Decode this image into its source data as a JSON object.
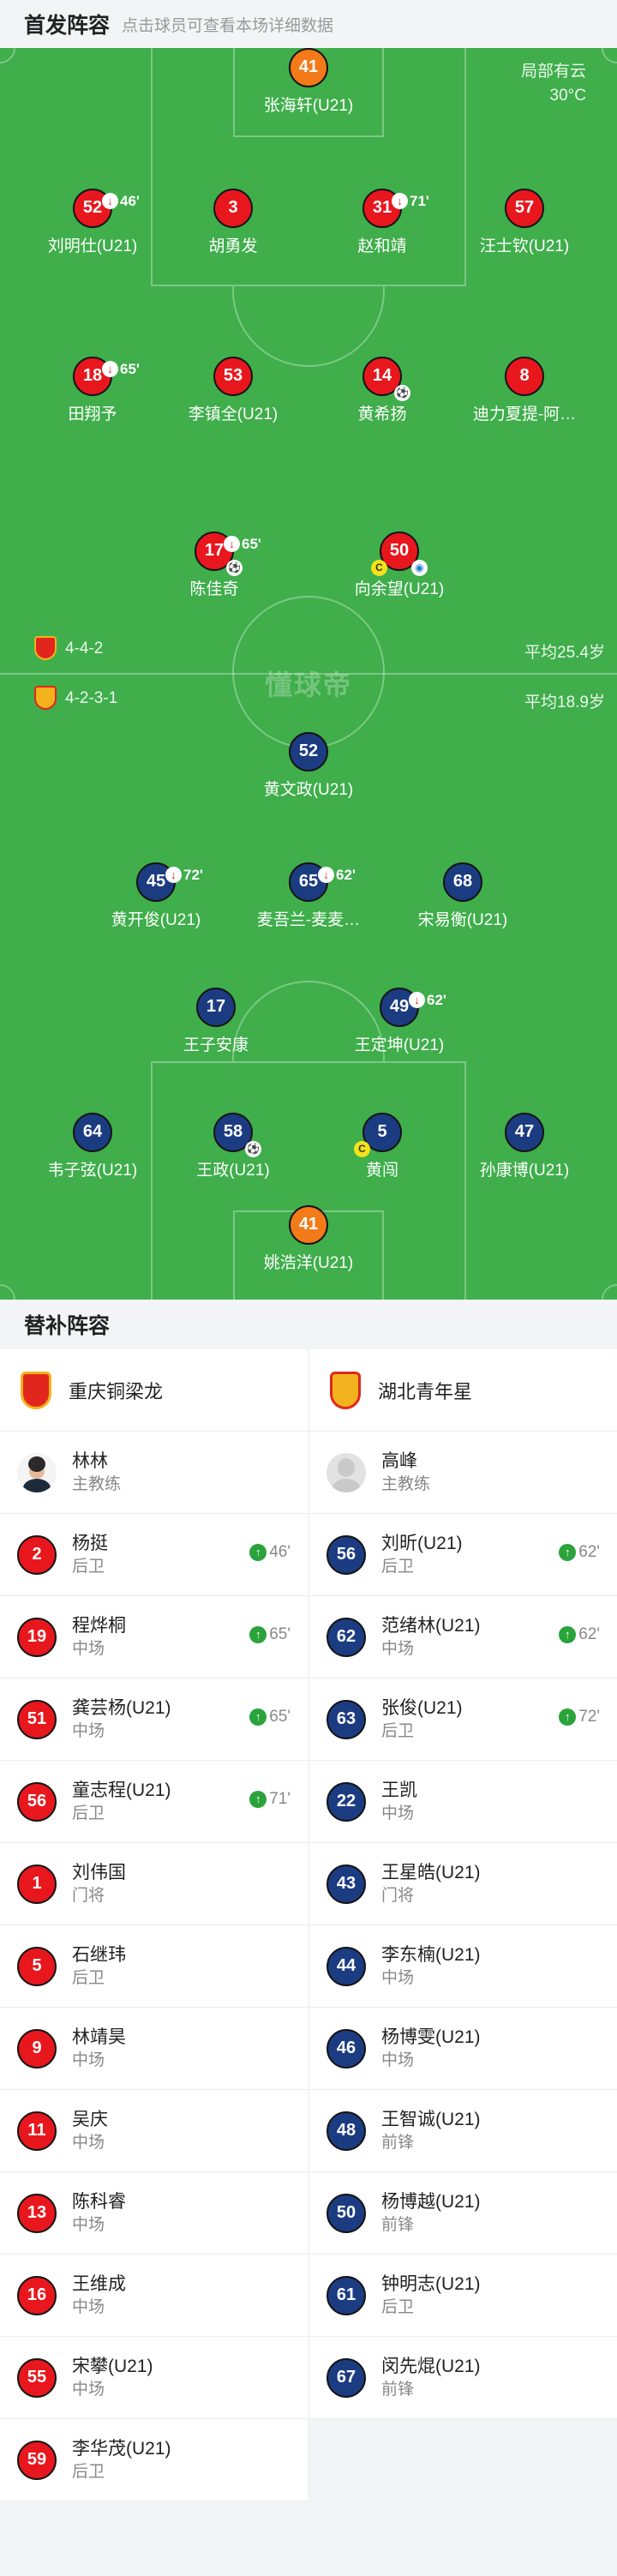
{
  "header": {
    "title": "首发阵容",
    "hint": "点击球员可查看本场详细数据"
  },
  "weather": {
    "condition": "局部有云",
    "temperature": "30°C"
  },
  "watermark": "懂球帝",
  "home": {
    "formation": "4-4-2",
    "avg_age": "平均25.4岁",
    "players": [
      {
        "number": "41",
        "name": "张海轩(U21)"
      },
      {
        "number": "52",
        "name": "刘明仕(U21)",
        "sub_min": "46'"
      },
      {
        "number": "3",
        "name": "胡勇发"
      },
      {
        "number": "31",
        "name": "赵和靖",
        "sub_min": "71'"
      },
      {
        "number": "57",
        "name": "汪士钦(U21)"
      },
      {
        "number": "18",
        "name": "田翔予",
        "sub_min": "65'"
      },
      {
        "number": "53",
        "name": "李镇全(U21)"
      },
      {
        "number": "14",
        "name": "黄希扬"
      },
      {
        "number": "8",
        "name": "迪力夏提-阿…"
      },
      {
        "number": "17",
        "name": "陈佳奇",
        "sub_min": "65'"
      },
      {
        "number": "50",
        "name": "向余望(U21)"
      }
    ]
  },
  "away": {
    "formation": "4-2-3-1",
    "avg_age": "平均18.9岁",
    "players": [
      {
        "number": "52",
        "name": "黄文政(U21)"
      },
      {
        "number": "45",
        "name": "黄开俊(U21)",
        "sub_min": "72'"
      },
      {
        "number": "65",
        "name": "麦吾兰-麦麦…",
        "sub_min": "62'"
      },
      {
        "number": "68",
        "name": "宋易衡(U21)"
      },
      {
        "number": "17",
        "name": "王子安康"
      },
      {
        "number": "49",
        "name": "王定坤(U21)",
        "sub_min": "62'"
      },
      {
        "number": "64",
        "name": "韦子弦(U21)"
      },
      {
        "number": "58",
        "name": "王政(U21)"
      },
      {
        "number": "5",
        "name": "黄闯"
      },
      {
        "number": "47",
        "name": "孙康博(U21)"
      },
      {
        "number": "41",
        "name": "姚浩洋(U21)"
      }
    ]
  },
  "bench": {
    "title": "替补阵容",
    "home_team": "重庆铜梁龙",
    "away_team": "湖北青年星",
    "home_coach": {
      "name": "林林",
      "role": "主教练"
    },
    "away_coach": {
      "name": "高峰",
      "role": "主教练"
    },
    "home_subs": [
      {
        "number": "2",
        "name": "杨挺",
        "position": "后卫",
        "sub_in": "46'"
      },
      {
        "number": "19",
        "name": "程烨桐",
        "position": "中场",
        "sub_in": "65'"
      },
      {
        "number": "51",
        "name": "龚芸杨(U21)",
        "position": "中场",
        "sub_in": "65'"
      },
      {
        "number": "56",
        "name": "童志程(U21)",
        "position": "后卫",
        "sub_in": "71'"
      },
      {
        "number": "1",
        "name": "刘伟国",
        "position": "门将"
      },
      {
        "number": "5",
        "name": "石继玮",
        "position": "后卫"
      },
      {
        "number": "9",
        "name": "林靖昊",
        "position": "中场"
      },
      {
        "number": "11",
        "name": "吴庆",
        "position": "中场"
      },
      {
        "number": "13",
        "name": "陈科睿",
        "position": "中场"
      },
      {
        "number": "16",
        "name": "王维成",
        "position": "中场"
      },
      {
        "number": "55",
        "name": "宋攀(U21)",
        "position": "中场"
      },
      {
        "number": "59",
        "name": "李华茂(U21)",
        "position": "后卫"
      }
    ],
    "away_subs": [
      {
        "number": "56",
        "name": "刘昕(U21)",
        "position": "后卫",
        "sub_in": "62'"
      },
      {
        "number": "62",
        "name": "范绪林(U21)",
        "position": "中场",
        "sub_in": "62'"
      },
      {
        "number": "63",
        "name": "张俊(U21)",
        "position": "后卫",
        "sub_in": "72'"
      },
      {
        "number": "22",
        "name": "王凯",
        "position": "中场"
      },
      {
        "number": "43",
        "name": "王星皓(U21)",
        "position": "门将"
      },
      {
        "number": "44",
        "name": "李东楠(U21)",
        "position": "中场"
      },
      {
        "number": "46",
        "name": "杨博雯(U21)",
        "position": "中场"
      },
      {
        "number": "48",
        "name": "王智诚(U21)",
        "position": "前锋"
      },
      {
        "number": "50",
        "name": "杨博越(U21)",
        "position": "前锋"
      },
      {
        "number": "61",
        "name": "钟明志(U21)",
        "position": "后卫"
      },
      {
        "number": "67",
        "name": "闵先焜(U21)",
        "position": "前锋"
      }
    ]
  }
}
